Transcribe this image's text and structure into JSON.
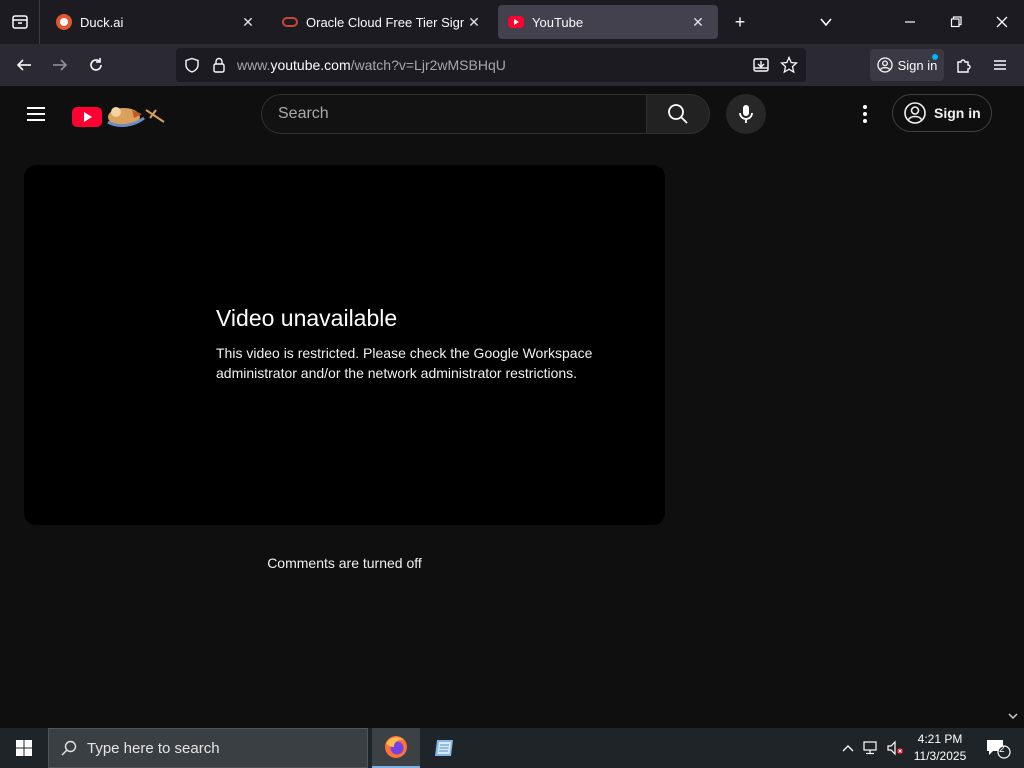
{
  "browser": {
    "tabs": [
      {
        "label": "Duck.ai",
        "favicon": "duckduckgo-icon"
      },
      {
        "label": "Oracle Cloud Free Tier Signup",
        "favicon": "oracle-icon"
      },
      {
        "label": "YouTube",
        "favicon": "youtube-icon",
        "active": true
      }
    ],
    "url_prefix": "www.",
    "url_domain": "youtube.com",
    "url_path": "/watch?v=Ljr2wMSBHqU",
    "signin_label": "Sign in"
  },
  "youtube": {
    "search_placeholder": "Search",
    "signin_label": "Sign in",
    "error_title": "Video unavailable",
    "error_message": "This video is restricted. Please check the Google Workspace administrator and/or the network administrator restrictions.",
    "comments_status": "Comments are turned off"
  },
  "taskbar": {
    "search_placeholder": "Type here to search",
    "time": "4:21 PM",
    "date": "11/3/2025",
    "notification_count": "2"
  },
  "colors": {
    "youtube_red": "#ff0033",
    "firefox_orange": "#ff7139",
    "page_bg": "#0f0f0f"
  }
}
